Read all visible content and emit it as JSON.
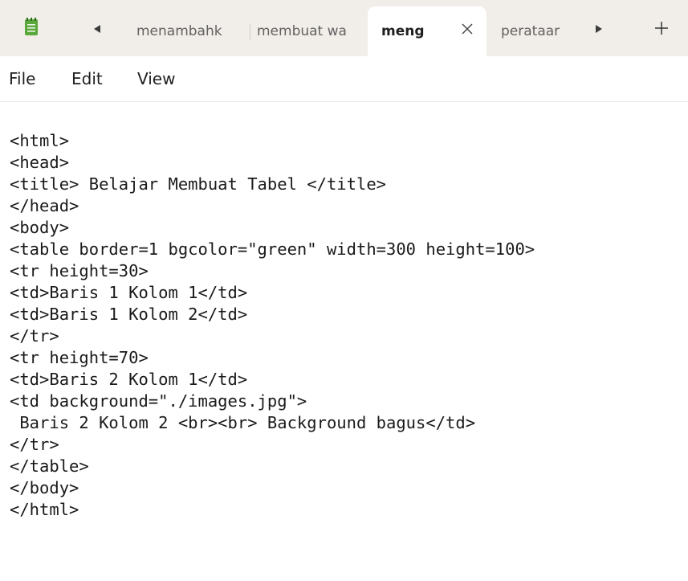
{
  "titlebar": {
    "app_icon": "notepad-icon",
    "scroll_left_icon": "caret-left-icon",
    "scroll_right_icon": "caret-right-icon",
    "new_tab_icon": "plus-icon",
    "tabs": [
      {
        "label": "menambahk",
        "active": false
      },
      {
        "label": "membuat wa",
        "active": false
      },
      {
        "label": "meng",
        "active": true,
        "close_icon": "close-icon"
      },
      {
        "label": "perataar",
        "active": false
      }
    ]
  },
  "menubar": {
    "file_label": "File",
    "edit_label": "Edit",
    "view_label": "View"
  },
  "editor": {
    "lines": [
      "<html>",
      "<head>",
      "<title> Belajar Membuat Tabel </title>",
      "</head>",
      "<body>",
      "<table border=1 bgcolor=\"green\" width=300 height=100>",
      "<tr height=30>",
      "<td>Baris 1 Kolom 1</td>",
      "<td>Baris 1 Kolom 2</td>",
      "</tr>",
      "<tr height=70>",
      "<td>Baris 2 Kolom 1</td>",
      "<td background=\"./images.jpg\">",
      " Baris 2 Kolom 2 <br><br> Background bagus</td>",
      "</tr>",
      "</table>",
      "</body>",
      "</html>"
    ]
  },
  "colors": {
    "tabbar_bg": "#f1ede8",
    "active_tab_bg": "#ffffff",
    "text": "#1a1a1a",
    "icon_accent": "#3a8f2e"
  }
}
